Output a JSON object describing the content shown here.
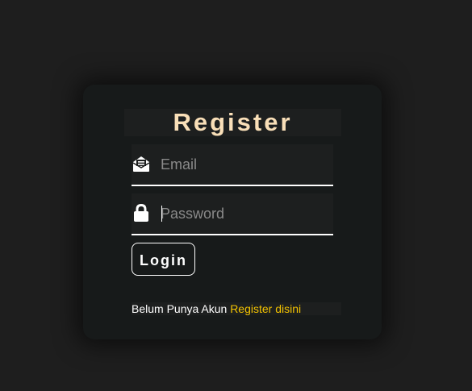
{
  "form": {
    "title": "Register",
    "email": {
      "placeholder": "Email",
      "value": "",
      "icon": "envelope-open-icon"
    },
    "password": {
      "placeholder": "Password",
      "value": "",
      "icon": "lock-icon"
    },
    "login_label": "Login",
    "footer": {
      "text": "Belum Punya Akun",
      "link_label": "Register disini"
    }
  },
  "colors": {
    "background": "#1e1e1e",
    "card": "#171a1a",
    "title": "#f9dfb8",
    "link": "#f2c200",
    "text": "#ffffff",
    "placeholder": "#8a8a8a"
  }
}
